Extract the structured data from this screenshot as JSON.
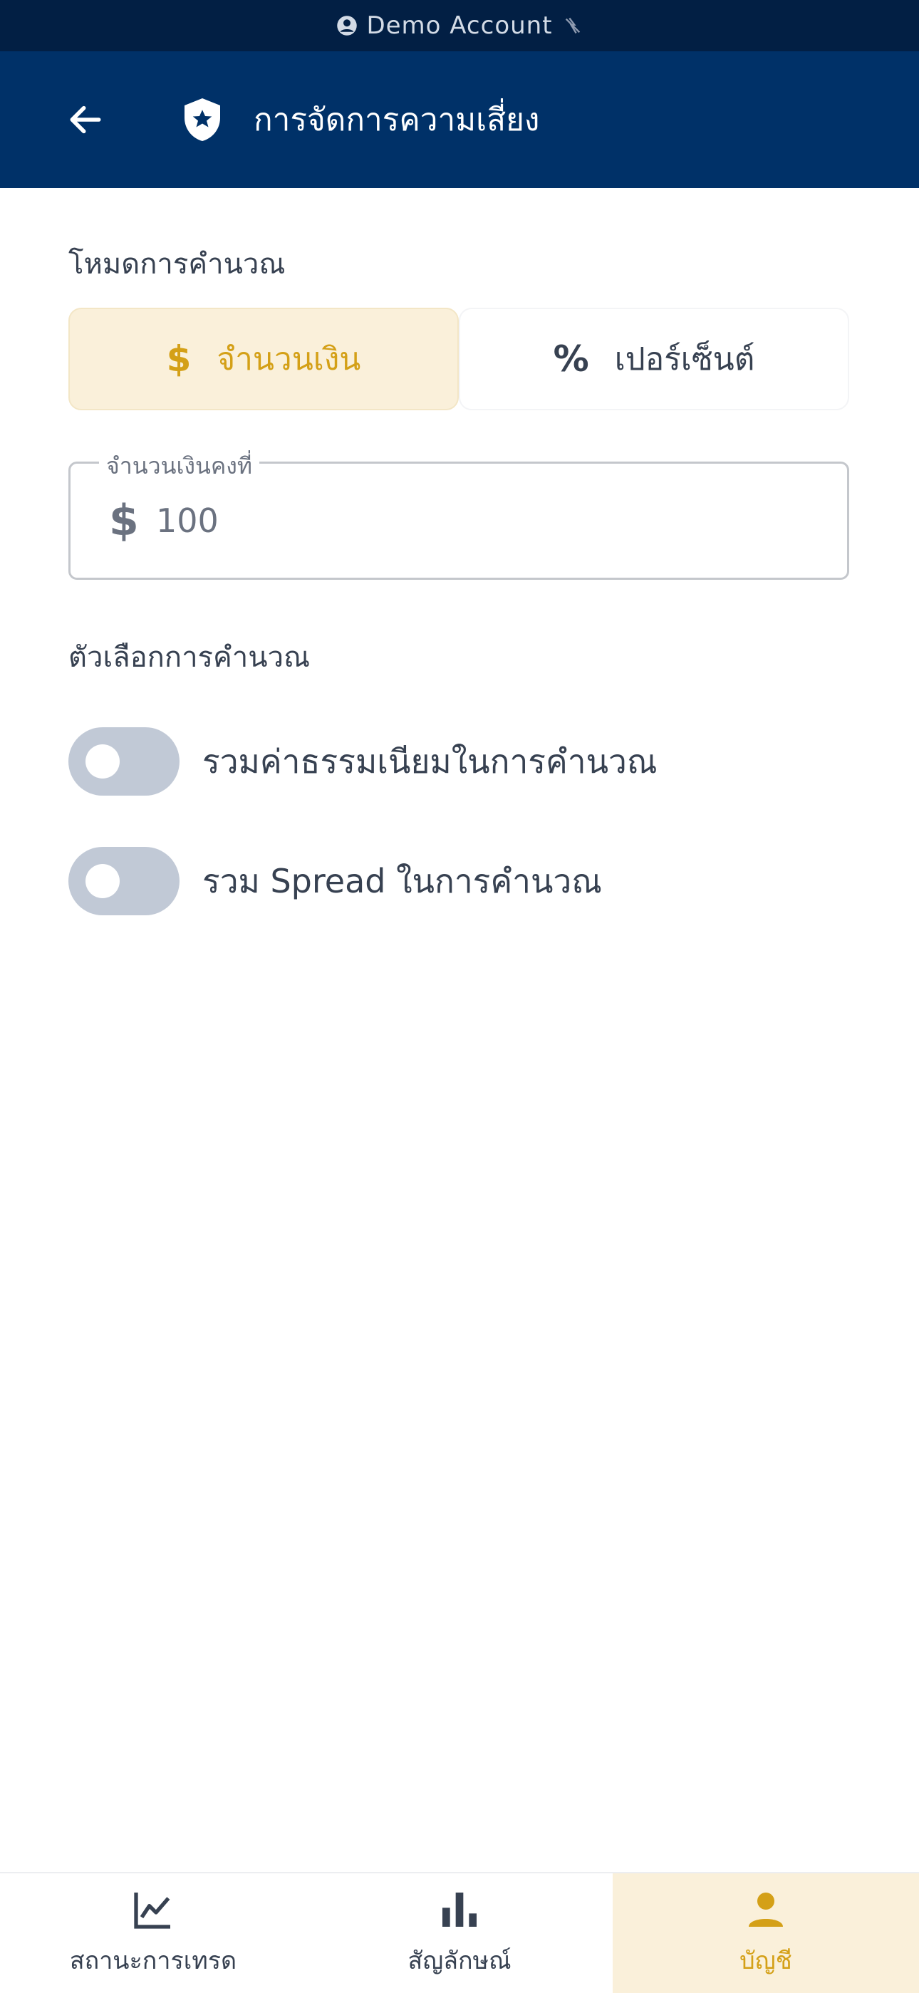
{
  "status_bar": {
    "account_label": "Demo Account",
    "user_icon": "account-circle-icon",
    "status_icon": "connection-off-icon"
  },
  "header": {
    "title": "การจัดการความเสี่ยง",
    "back_icon": "arrow-left-icon",
    "title_icon": "shield-star-icon"
  },
  "calc_mode": {
    "label": "โหมดการคำนวณ",
    "options": [
      {
        "label": "จำนวนเงิน",
        "icon": "$",
        "selected": true
      },
      {
        "label": "เปอร์เซ็นต์",
        "icon": "%",
        "selected": false
      }
    ]
  },
  "fixed_amount": {
    "label": "จำนวนเงินคงที่",
    "currency_icon": "$",
    "value": "100"
  },
  "options": {
    "label": "ตัวเลือกการคำนวณ",
    "toggles": [
      {
        "label": "รวมค่าธรรมเนียมในการคำนวณ",
        "on": false
      },
      {
        "label": "รวม Spread ในการคำนวณ",
        "on": false
      }
    ]
  },
  "bottom_nav": {
    "items": [
      {
        "label": "สถานะการเทรด",
        "icon": "line-chart-icon",
        "active": false
      },
      {
        "label": "สัญลักษณ์",
        "icon": "bar-chart-icon",
        "active": false
      },
      {
        "label": "บัญชี",
        "icon": "person-icon",
        "active": true
      }
    ]
  },
  "colors": {
    "header_bg": "#003168",
    "status_bg": "#021f44",
    "accent": "#d4a017",
    "accent_bg": "#faf0da",
    "toggle_off": "#c1c9d6"
  }
}
